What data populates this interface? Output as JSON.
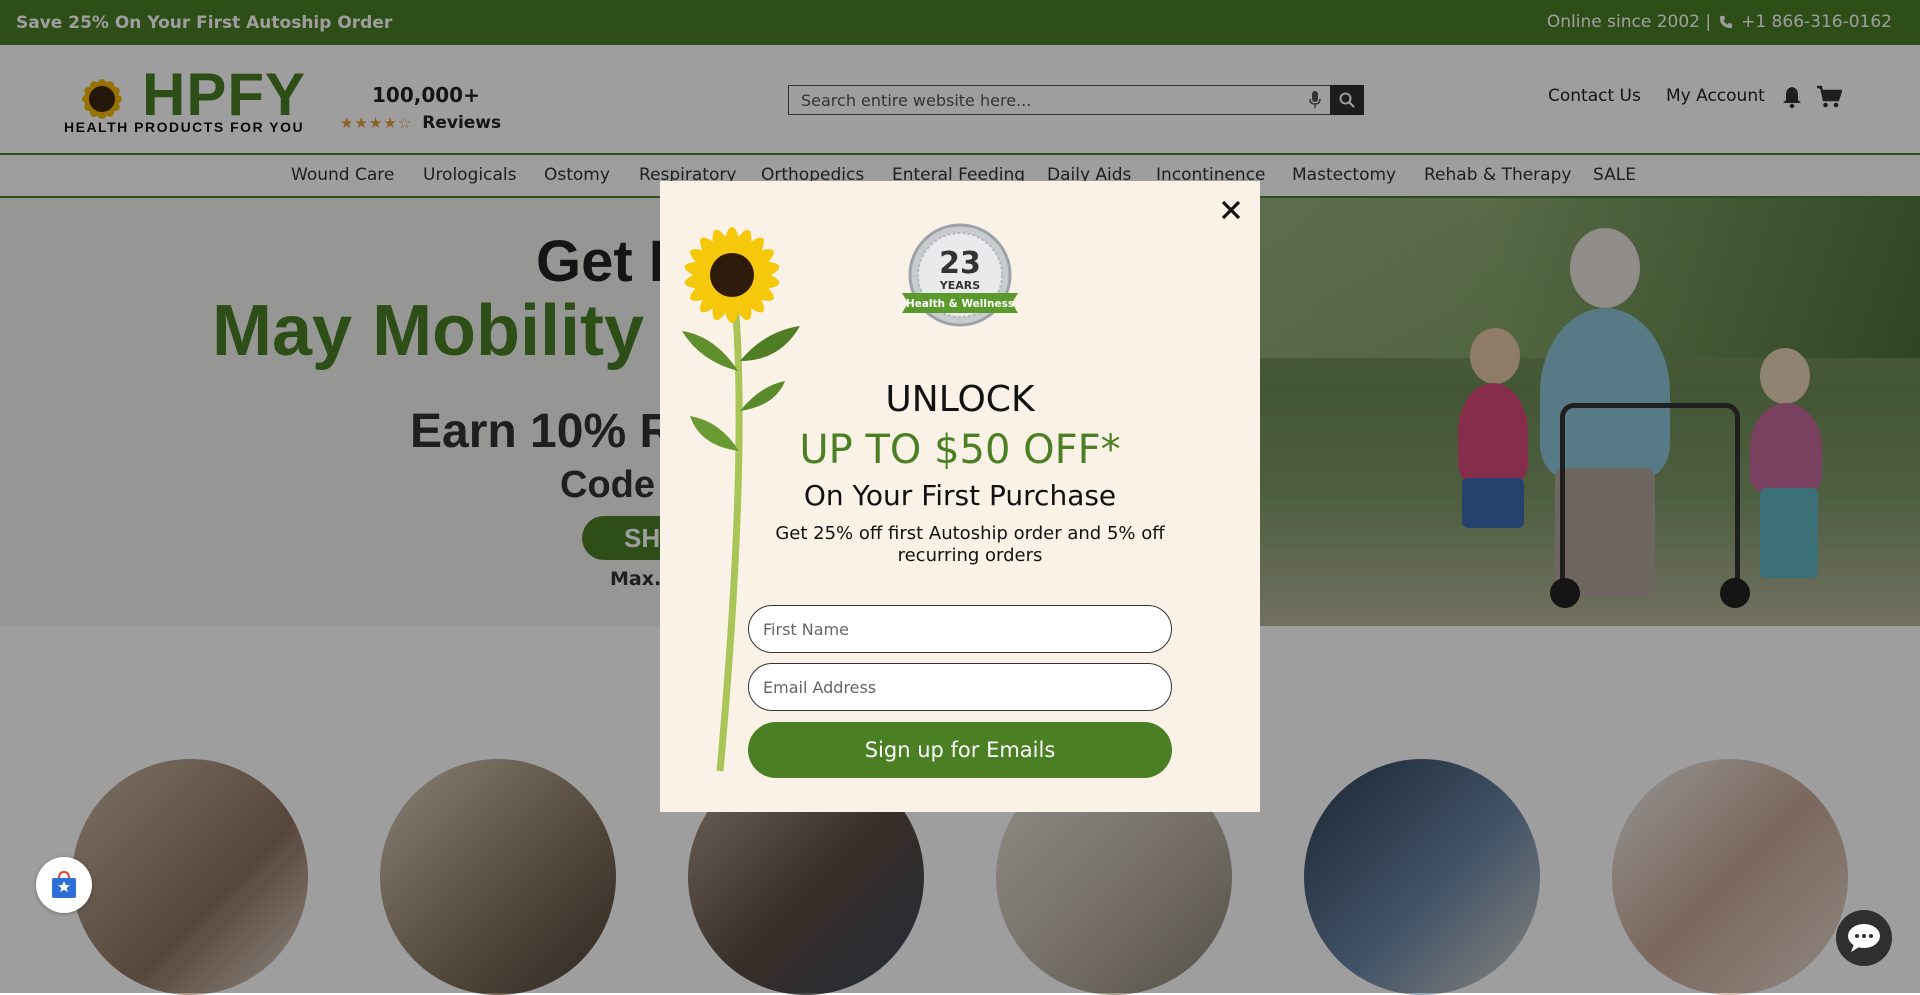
{
  "promo": {
    "left_text": "Save 25% On Your First Autoship Order",
    "online_text": "Online since 2002 |",
    "phone": "+1 866-316-0162"
  },
  "header": {
    "logo_text": "HPFY",
    "logo_subtext": "HEALTH PRODUCTS FOR YOU",
    "reviews_count": "100,000+",
    "reviews_stars": "★★★★☆",
    "reviews_label": "Reviews",
    "search_placeholder": "Search entire website here...",
    "contact_label": "Contact Us",
    "account_label": "My Account"
  },
  "nav": {
    "items": [
      {
        "label": "Wound Care"
      },
      {
        "label": "Urologicals"
      },
      {
        "label": "Ostomy"
      },
      {
        "label": "Respiratory"
      },
      {
        "label": "Orthopedics"
      },
      {
        "label": "Enteral Feeding"
      },
      {
        "label": "Daily Aids"
      },
      {
        "label": "Incontinence"
      },
      {
        "label": "Mastectomy"
      },
      {
        "label": "Rehab & Therapy"
      },
      {
        "label": "SALE"
      }
    ]
  },
  "hero": {
    "title_line1": "Get I",
    "title_line2": "May Mobility",
    "earn": "Earn 10% R",
    "code": "Code",
    "shop_button": "SH",
    "max": "Max."
  },
  "modal": {
    "badge_number": "23",
    "badge_years": "YEARS",
    "badge_ribbon": "Health & Wellness",
    "unlock": "UNLOCK",
    "offer": "UP TO $50 OFF*",
    "first_purchase": "On Your First Purchase",
    "description": "Get 25% off first Autoship order and 5% off recurring orders",
    "first_name_placeholder": "First Name",
    "email_placeholder": "Email Address",
    "signup_button": "Sign up for Emails"
  },
  "colors": {
    "brand_green": "#4a7f24",
    "modal_bg": "#faf2e6",
    "overlay": "rgba(0,0,0,0.38)"
  }
}
